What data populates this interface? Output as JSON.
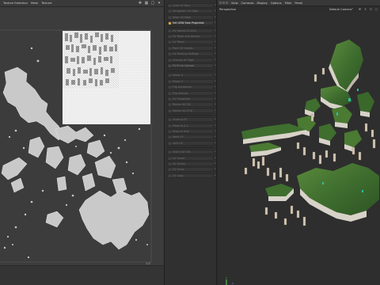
{
  "uv_editor": {
    "menu": [
      "Texture Selection",
      "Mesh",
      "Texture"
    ],
    "coordinate_readout": "1.0"
  },
  "tool_panel": {
    "buttons": [
      {
        "label": "Grab UV Face",
        "state": "dim"
      },
      {
        "label": "Straighten UV Edge",
        "state": "dim"
      },
      {
        "label": "Align UV Edge",
        "state": "dim"
      },
      {
        "label": "Set UVW from Projection",
        "state": "active"
      },
      {
        "label": "UV Islands to Grid",
        "state": "dim"
      },
      {
        "label": "UV Mesh and Islands",
        "state": "dim"
      },
      {
        "label": "UV Relax",
        "state": "dim"
      },
      {
        "label": "Pack UV Islands",
        "state": "dim"
      },
      {
        "label": "UV Packing Settings",
        "state": "dim"
      },
      {
        "label": "Unwrap UV Tags",
        "state": "dim"
      },
      {
        "label": "Fit UV to Canvas",
        "state": "normal"
      },
      {
        "label": "Mirror U",
        "state": "dim"
      },
      {
        "label": "Mirror V",
        "state": "dim"
      },
      {
        "label": "Flip Horizontal",
        "state": "dim"
      },
      {
        "label": "Flip Vertical",
        "state": "dim"
      },
      {
        "label": "UV Transform",
        "state": "dim"
      },
      {
        "label": "Rotate 90 CW",
        "state": "dim"
      },
      {
        "label": "Rotate 90 CCW",
        "state": "dim"
      },
      {
        "label": "Scale to Fit",
        "state": "dim"
      },
      {
        "label": "Move to 0-1",
        "state": "dim"
      },
      {
        "label": "Snap to Grid",
        "state": "dim"
      },
      {
        "label": "Weld UV",
        "state": "dim"
      },
      {
        "label": "Split UV",
        "state": "dim"
      },
      {
        "label": "Select All UVs",
        "state": "dim"
      },
      {
        "label": "UV Invert",
        "state": "dim"
      },
      {
        "label": "UV Shrink",
        "state": "dim"
      },
      {
        "label": "UV Grow",
        "state": "dim"
      },
      {
        "label": "UV Loop",
        "state": "dim"
      }
    ]
  },
  "viewport": {
    "menu": [
      "View",
      "Cameras",
      "Display",
      "Options",
      "Filter",
      "Panel"
    ],
    "title": "Perspective",
    "camera": "Default Camera°"
  },
  "colors": {
    "accent": "#d9a23b",
    "island_fill": "#c9c9c9",
    "terrain_green": "#3f6e2f",
    "terrain_side": "#d8d3c8"
  }
}
